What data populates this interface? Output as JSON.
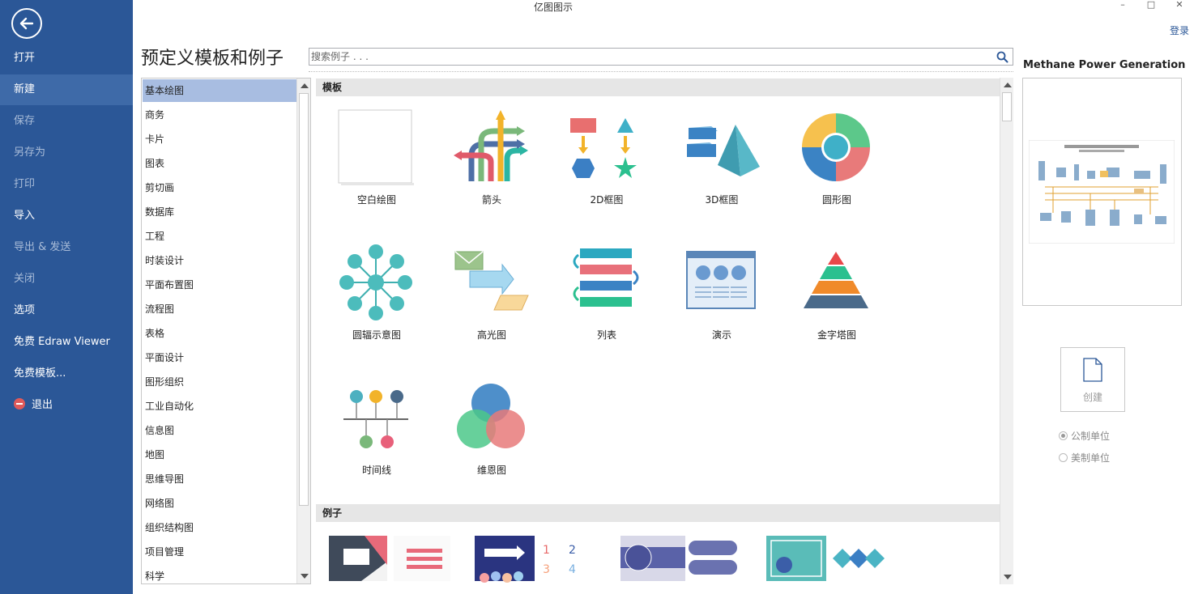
{
  "window": {
    "title": "亿图图示",
    "login": "登录",
    "minimize": "–",
    "maximize": "□",
    "close": "✕"
  },
  "sidebar": {
    "items": [
      {
        "label": "打开"
      },
      {
        "label": "新建"
      },
      {
        "label": "保存"
      },
      {
        "label": "另存为"
      },
      {
        "label": "打印"
      },
      {
        "label": "导入"
      },
      {
        "label": "导出 & 发送"
      },
      {
        "label": "关闭"
      },
      {
        "label": "选项"
      },
      {
        "label": "免费 Edraw Viewer"
      },
      {
        "label": "免费模板..."
      },
      {
        "label": "退出"
      }
    ]
  },
  "main": {
    "title": "预定义模板和例子",
    "search_placeholder": "搜索例子 . . ."
  },
  "categories": [
    "基本绘图",
    "商务",
    "卡片",
    "图表",
    "剪切画",
    "数据库",
    "工程",
    "时装设计",
    "平面布置图",
    "流程图",
    "表格",
    "平面设计",
    "图形组织",
    "工业自动化",
    "信息图",
    "地图",
    "思维导图",
    "网络图",
    "组织结构图",
    "项目管理",
    "科学"
  ],
  "sections": {
    "templates": "模板",
    "examples": "例子"
  },
  "templates": [
    "空白绘图",
    "箭头",
    "2D框图",
    "3D框图",
    "圆形图",
    "圆辐示意图",
    "高光图",
    "列表",
    "演示",
    "金字塔图",
    "时间线",
    "维恩图"
  ],
  "preview": {
    "title": "Methane Power Generation P...",
    "create_label": "创建",
    "unit_metric": "公制单位",
    "unit_us": "美制单位"
  },
  "colors": {
    "sidebar": "#2b5797",
    "selected": "#a8bde1",
    "accent": "#2b5797"
  }
}
